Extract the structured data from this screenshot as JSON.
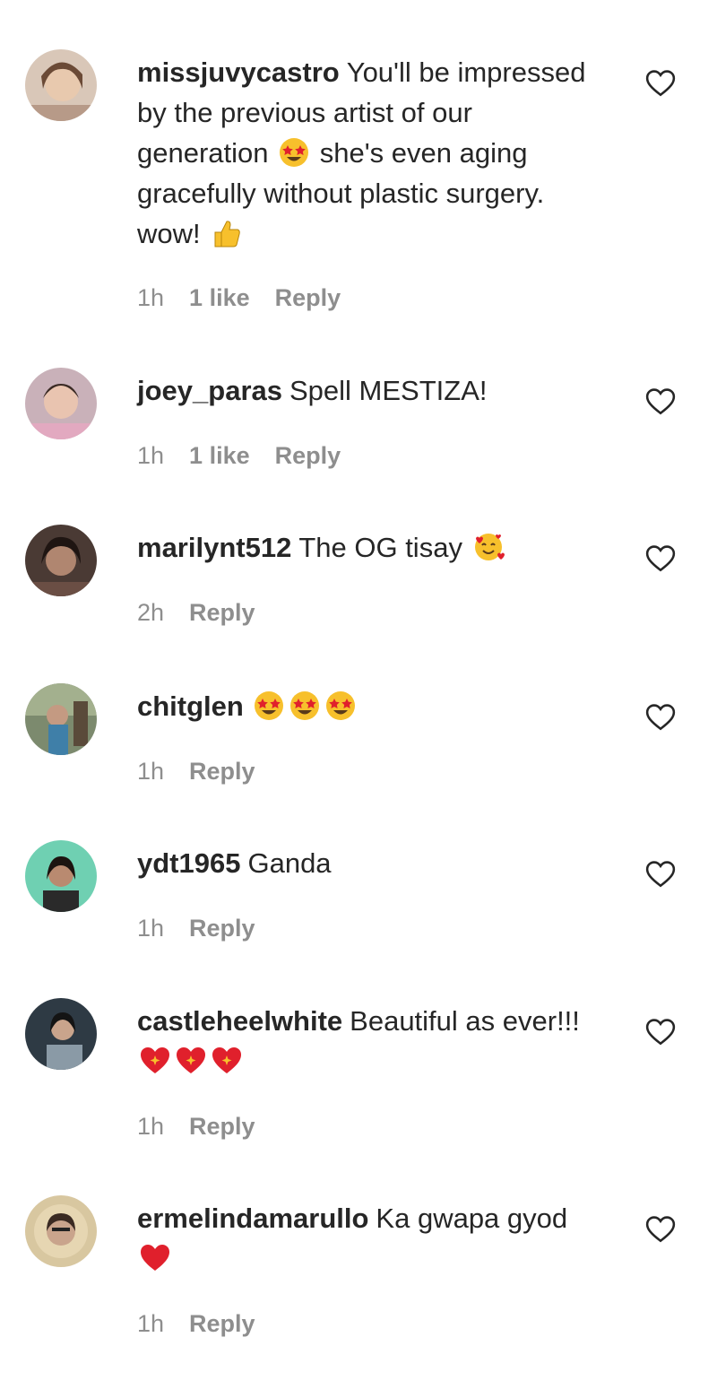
{
  "comments": [
    {
      "username": "missjuvycastro",
      "text_parts": [
        "You'll be impressed by the previous artist of our generation ",
        " she's even aging gracefully without plastic surgery. wow! "
      ],
      "emojis": [
        "star-struck-emoji",
        "thumbs-up-emoji"
      ],
      "time": "1h",
      "likes": "1 like",
      "reply": "Reply"
    },
    {
      "username": "joey_paras",
      "text": "Spell MESTIZA!",
      "time": "1h",
      "likes": "1 like",
      "reply": "Reply"
    },
    {
      "username": "marilynt512",
      "text": "The OG tisay ",
      "emojis": [
        "smiling-face-with-hearts-emoji"
      ],
      "time": "2h",
      "reply": "Reply"
    },
    {
      "username": "chitglen",
      "emojis": [
        "star-struck-emoji",
        "star-struck-emoji",
        "star-struck-emoji"
      ],
      "time": "1h",
      "reply": "Reply"
    },
    {
      "username": "ydt1965",
      "text": "Ganda",
      "time": "1h",
      "reply": "Reply"
    },
    {
      "username": "castleheelwhite",
      "text": "Beautiful as ever!!!",
      "emojis": [
        "sparkling-heart-emoji",
        "sparkling-heart-emoji",
        "sparkling-heart-emoji"
      ],
      "time": "1h",
      "reply": "Reply"
    },
    {
      "username": "ermelindamarullo",
      "text": "Ka gwapa gyod",
      "emojis": [
        "red-heart-emoji"
      ],
      "time": "1h",
      "reply": "Reply"
    }
  ],
  "colors": {
    "text": "#262626",
    "meta": "#8e8e8e",
    "heart_outline": "#262626",
    "emoji_yellow": "#f7c02c",
    "emoji_red": "#e0202c"
  }
}
